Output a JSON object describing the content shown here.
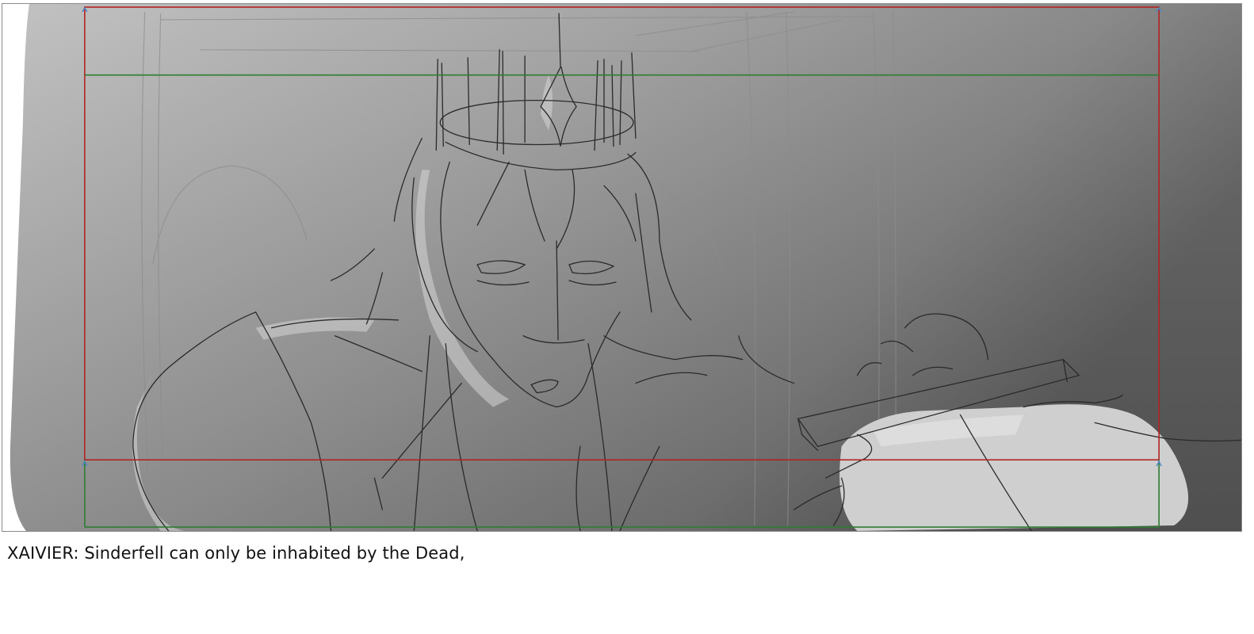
{
  "storyboard_panel": {
    "image_label": "storyboard sketch: figure wearing spiked crown",
    "caption": "XAIVIER: Sinderfell can only be inhabited by the Dead,"
  },
  "colors": {
    "safe_frame_red": "#b22222",
    "title_safe_green": "#2e7d32",
    "guide_marker_blue": "#4a86c5"
  }
}
